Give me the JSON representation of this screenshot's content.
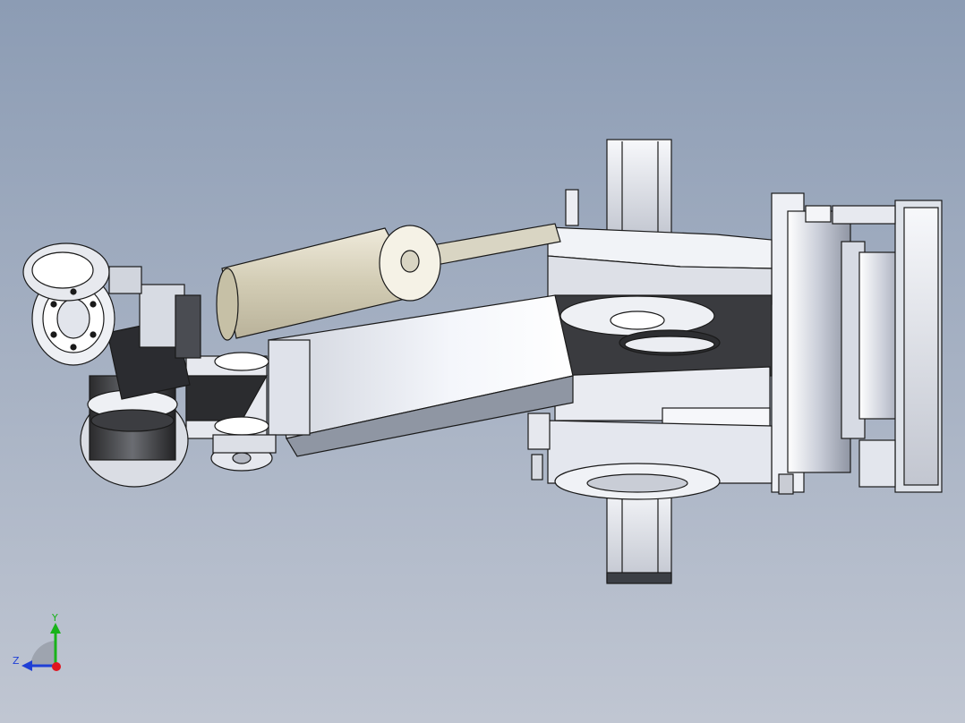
{
  "viewport": {
    "background_top": "#8c9cb4",
    "background_bottom": "#c0c6d2"
  },
  "model": {
    "body_color": "#e6e8ef",
    "cylinder_color": "#d9d4c0",
    "outline_color": "#1a1a1a",
    "accent_red": "#c0262e"
  },
  "triad": {
    "y_label": "Y",
    "z_label": "Z",
    "y_color": "#19b319",
    "z_color": "#1f3fd6",
    "x_color": "#e0141e"
  }
}
